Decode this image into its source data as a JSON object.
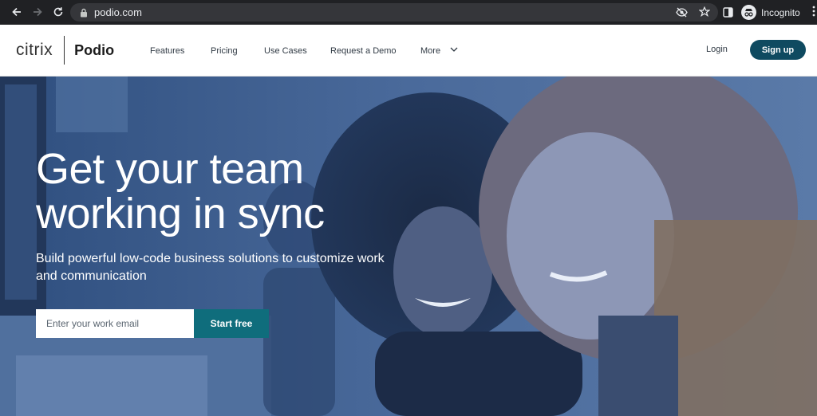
{
  "browser": {
    "url": "podio.com",
    "profile_label": "Incognito"
  },
  "site": {
    "logo": {
      "brand": "citrix",
      "product": "Podio"
    },
    "nav": [
      {
        "label": "Features"
      },
      {
        "label": "Pricing"
      },
      {
        "label": "Use Cases"
      },
      {
        "label": "Request a Demo"
      },
      {
        "label": "More"
      }
    ],
    "login_label": "Login",
    "signup_label": "Sign up"
  },
  "hero": {
    "title_line1": "Get your team",
    "title_line2": "working in sync",
    "subtitle": "Build powerful low-code business solutions to customize work and communication",
    "email_placeholder": "Enter your work email",
    "cta_label": "Start free"
  },
  "colors": {
    "chrome_bg": "#202124",
    "brand_dark": "#0f4a60",
    "cta_teal": "#0f6d7c",
    "hero_overlay": "#3c5f90"
  }
}
